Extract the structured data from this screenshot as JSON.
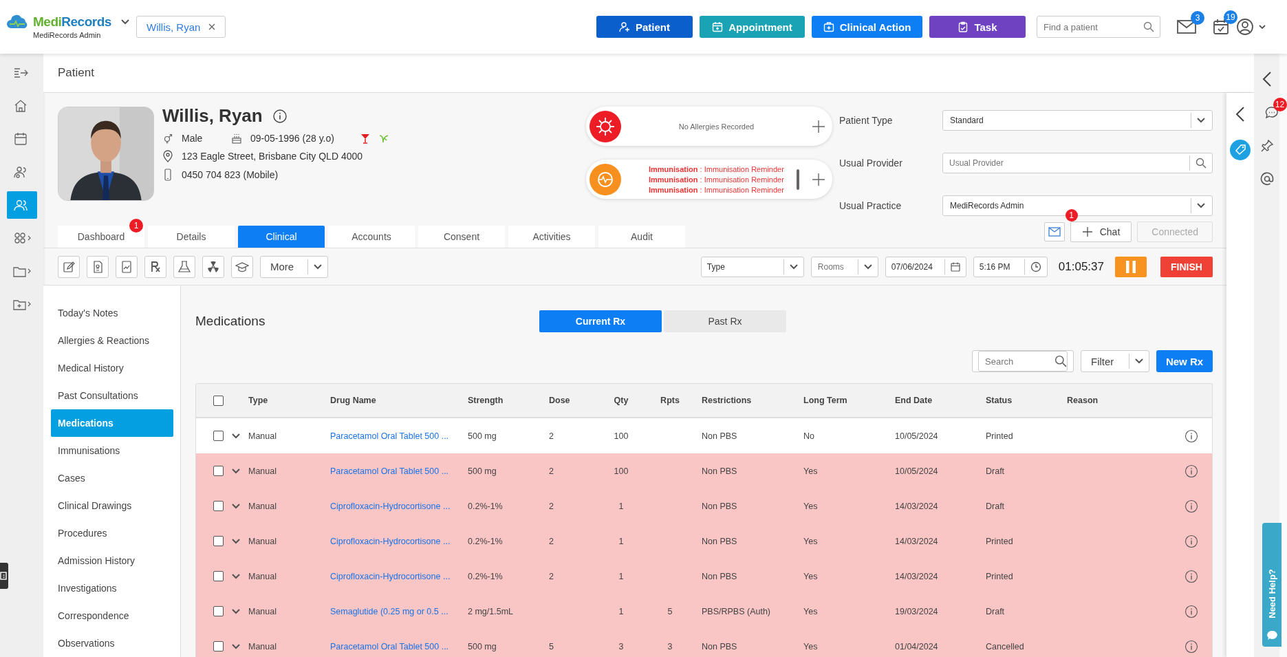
{
  "header": {
    "brand": [
      "Medi",
      "Records"
    ],
    "brand_sub": "MediRecords Admin",
    "patient_chip": "Willis, Ryan",
    "actions": [
      {
        "label": "Patient",
        "kind": "patient"
      },
      {
        "label": "Appointment",
        "kind": "appointment"
      },
      {
        "label": "Clinical Action",
        "kind": "clinical"
      },
      {
        "label": "Task",
        "kind": "task"
      }
    ],
    "search": {
      "placeholder": "Find a patient"
    },
    "mail_badge": "3",
    "calendar_badge": "19"
  },
  "nav_rail": [
    {
      "kind": "expand",
      "selected": false
    },
    {
      "kind": "home",
      "selected": false
    },
    {
      "kind": "calendar",
      "selected": false
    },
    {
      "kind": "contacts",
      "selected": false
    },
    {
      "kind": "patients",
      "selected": true
    },
    {
      "kind": "apps",
      "selected": false
    },
    {
      "kind": "folder",
      "selected": false
    },
    {
      "kind": "folder-add",
      "selected": false
    }
  ],
  "page_title": "Patient",
  "patient": {
    "name": "Willis, Ryan",
    "gender": "Male",
    "dob": "09-05-1996 (28 y.o)",
    "address": "123 Eagle Street, Brisbane City QLD 4000",
    "phone": "0450 704 823 (Mobile)"
  },
  "alerts": {
    "allergies": "No Allergies Recorded",
    "immunisations": [
      "**Immunisation** : Immunisation Reminder",
      "**Immunisation** : Immunisation Reminder",
      "**Immunisation** : Immunisation Reminder"
    ]
  },
  "patient_fields": [
    {
      "label": "Patient Type",
      "kind": "select",
      "value": "Standard"
    },
    {
      "label": "Usual Provider",
      "kind": "search",
      "placeholder": "Usual Provider"
    },
    {
      "label": "Usual Practice",
      "kind": "select",
      "value": "MediRecords Admin"
    }
  ],
  "message_badge": "1",
  "chat_button": "Chat",
  "connected_button": {
    "label": "Connected",
    "disabled": true
  },
  "tabs": [
    {
      "label": "Dashboard",
      "selected": false,
      "badge": "1"
    },
    {
      "label": "Details",
      "selected": false
    },
    {
      "label": "Clinical",
      "selected": true
    },
    {
      "label": "Accounts",
      "selected": false
    },
    {
      "label": "Consent",
      "selected": false
    },
    {
      "label": "Activities",
      "selected": false
    },
    {
      "label": "Audit",
      "selected": false
    }
  ],
  "toolbar": {
    "tools": [
      {
        "kind": "note"
      },
      {
        "kind": "document"
      },
      {
        "kind": "chart"
      },
      {
        "kind": "rx"
      },
      {
        "kind": "lab"
      },
      {
        "kind": "radiation"
      },
      {
        "kind": "education"
      }
    ],
    "more": "More",
    "type_select": "Type",
    "rooms": {
      "placeholder": "Rooms"
    },
    "date": "07/06/2024",
    "time": "5:16 PM",
    "timer": "01:05:37",
    "finish": "FINISH"
  },
  "clinical_menu": [
    {
      "label": "Today's Notes",
      "selected": false
    },
    {
      "label": "Allergies & Reactions",
      "selected": false
    },
    {
      "label": "Medical History",
      "selected": false
    },
    {
      "label": "Past Consultations",
      "selected": false
    },
    {
      "label": "Medications",
      "selected": true
    },
    {
      "label": "Immunisations",
      "selected": false
    },
    {
      "label": "Cases",
      "selected": false
    },
    {
      "label": "Clinical Drawings",
      "selected": false
    },
    {
      "label": "Procedures",
      "selected": false
    },
    {
      "label": "Admission History",
      "selected": false
    },
    {
      "label": "Investigations",
      "selected": false
    },
    {
      "label": "Correspondence",
      "selected": false
    },
    {
      "label": "Observations",
      "selected": false
    }
  ],
  "medications": {
    "title": "Medications",
    "views": [
      {
        "label": "Current Rx",
        "selected": true
      },
      {
        "label": "Past Rx",
        "selected": false
      }
    ],
    "search": {
      "placeholder": "Search"
    },
    "filter": "Filter",
    "new_rx": "New Rx",
    "all_checked": false,
    "columns": [
      "Type",
      "Drug Name",
      "Strength",
      "Dose",
      "Qty",
      "Rpts",
      "Restrictions",
      "Long Term",
      "End Date",
      "Status",
      "Reason"
    ],
    "rows": [
      {
        "checked": false,
        "highlighted": false,
        "type": "Manual",
        "drug": "Paracetamol Oral Tablet 500 ...",
        "strength": "500 mg",
        "dose": "2",
        "qty": "100",
        "restrictions": "Non PBS",
        "long_term": "No",
        "end_date": "10/05/2024",
        "status": "Printed"
      },
      {
        "checked": false,
        "highlighted": true,
        "type": "Manual",
        "drug": "Paracetamol Oral Tablet 500 ...",
        "strength": "500 mg",
        "dose": "2",
        "qty": "100",
        "restrictions": "Non PBS",
        "long_term": "Yes",
        "end_date": "10/05/2024",
        "status": "Draft"
      },
      {
        "checked": false,
        "highlighted": true,
        "type": "Manual",
        "drug": "Ciprofloxacin-Hydrocortisone ...",
        "strength": "0.2%-1%",
        "dose": "2",
        "qty": "1",
        "restrictions": "Non PBS",
        "long_term": "Yes",
        "end_date": "14/03/2024",
        "status": "Draft"
      },
      {
        "checked": false,
        "highlighted": true,
        "type": "Manual",
        "drug": "Ciprofloxacin-Hydrocortisone ...",
        "strength": "0.2%-1%",
        "dose": "2",
        "qty": "1",
        "restrictions": "Non PBS",
        "long_term": "Yes",
        "end_date": "14/03/2024",
        "status": "Printed"
      },
      {
        "checked": false,
        "highlighted": true,
        "type": "Manual",
        "drug": "Ciprofloxacin-Hydrocortisone ...",
        "strength": "0.2%-1%",
        "dose": "2",
        "qty": "1",
        "restrictions": "Non PBS",
        "long_term": "Yes",
        "end_date": "14/03/2024",
        "status": "Printed"
      },
      {
        "checked": false,
        "highlighted": true,
        "type": "Manual",
        "drug": "Semaglutide (0.25 mg or 0.5 ...",
        "strength": "2 mg/1.5mL",
        "qty": "1",
        "rpts": "5",
        "restrictions": "PBS/RPBS (Auth)",
        "long_term": "Yes",
        "end_date": "19/03/2024",
        "status": "Draft"
      },
      {
        "checked": false,
        "highlighted": true,
        "type": "Manual",
        "drug": "Paracetamol Oral Tablet 500 ...",
        "strength": "500 mg",
        "dose": "5",
        "qty": "3",
        "rpts": "3",
        "restrictions": "Non PBS",
        "long_term": "Yes",
        "end_date": "01/04/2024",
        "status": "Cancelled"
      }
    ]
  },
  "right_rail": {
    "chat_badge": "12"
  },
  "help_tab": "Need Help?"
}
